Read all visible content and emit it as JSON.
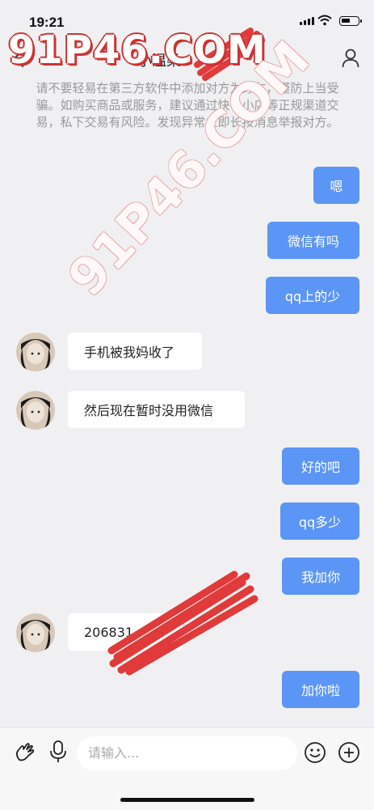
{
  "status": {
    "time": "19:21"
  },
  "nav": {
    "title": "小温柔"
  },
  "notice": "请不要轻易在第三方软件中添加对方为好友，谨防上当受骗。如购买商品或服务，建议通过快手小店等正规渠道交易，私下交易有风险。发现异常立即长按消息举报对方。",
  "watermark": {
    "corner": "91P46.COM",
    "diagonal": "91P46.COM"
  },
  "messages": [
    {
      "side": "right",
      "text": "嗯"
    },
    {
      "side": "right",
      "text": "微信有吗"
    },
    {
      "side": "right",
      "text": "qq上的少"
    },
    {
      "side": "left",
      "text": "手机被我妈收了"
    },
    {
      "side": "left",
      "text": "然后现在暂时没用微信"
    },
    {
      "side": "right",
      "text": "好的吧"
    },
    {
      "side": "right",
      "text": "qq多少"
    },
    {
      "side": "right",
      "text": "我加你"
    },
    {
      "side": "left",
      "text": "206831"
    },
    {
      "side": "right",
      "text": "加你啦"
    }
  ],
  "composer": {
    "placeholder": "请输入..."
  },
  "colors": {
    "bubble_right": "#5b95f5",
    "background": "#f0f0f2",
    "redaction": "#e03a3a"
  },
  "icons": [
    "back-chevron-icon",
    "profile-icon",
    "wave-hand-icon",
    "microphone-icon",
    "emoji-icon",
    "add-icon"
  ]
}
